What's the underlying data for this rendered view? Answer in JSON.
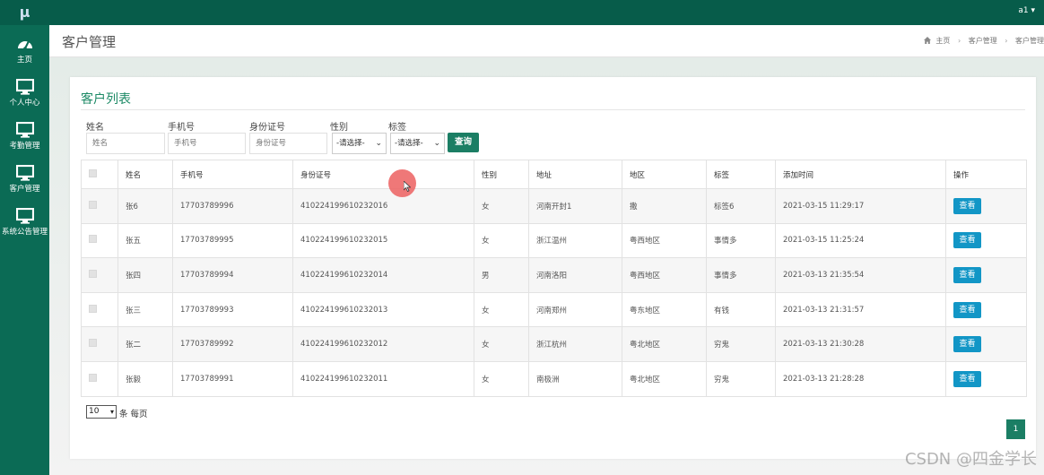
{
  "app": {
    "logo": "μ",
    "user": "a1 ▾"
  },
  "colors": {
    "sidebar": "#0b6b55",
    "topbar": "#075c4a",
    "accent": "#1b7e64",
    "view_button": "#1296c6",
    "title": "#1d8a66"
  },
  "sidebar": {
    "items": [
      {
        "label": "主页",
        "icon": "dashboard-icon"
      },
      {
        "label": "个人中心",
        "icon": "monitor-icon"
      },
      {
        "label": "考勤管理",
        "icon": "monitor-icon"
      },
      {
        "label": "客户管理",
        "icon": "monitor-icon"
      },
      {
        "label": "系统公告管理",
        "icon": "monitor-icon"
      }
    ]
  },
  "header": {
    "title": "客户管理",
    "breadcrumb": [
      "主页",
      "客户管理",
      "客户管理"
    ]
  },
  "panel": {
    "title": "客户列表"
  },
  "search": {
    "fields": [
      {
        "label": "姓名",
        "placeholder": "姓名"
      },
      {
        "label": "手机号",
        "placeholder": "手机号"
      },
      {
        "label": "身份证号",
        "placeholder": "身份证号"
      }
    ],
    "gender": {
      "label": "性别",
      "value": "-请选择-"
    },
    "tag": {
      "label": "标签",
      "value": "-请选择-"
    },
    "button": "查询"
  },
  "table": {
    "headers": [
      "姓名",
      "手机号",
      "身份证号",
      "性别",
      "地址",
      "地区",
      "标签",
      "添加时间",
      "操作"
    ],
    "rows": [
      {
        "name": "张6",
        "phone": "17703789996",
        "id_number": "410224199610232016",
        "gender": "女",
        "address": "河南开封1",
        "region": "撒",
        "tag": "标签6",
        "time": "2021-03-15 11:29:17",
        "action": "查看"
      },
      {
        "name": "张五",
        "phone": "17703789995",
        "id_number": "410224199610232015",
        "gender": "女",
        "address": "浙江温州",
        "region": "粤西地区",
        "tag": "事情多",
        "time": "2021-03-15 11:25:24",
        "action": "查看"
      },
      {
        "name": "张四",
        "phone": "17703789994",
        "id_number": "410224199610232014",
        "gender": "男",
        "address": "河南洛阳",
        "region": "粤西地区",
        "tag": "事情多",
        "time": "2021-03-13 21:35:54",
        "action": "查看"
      },
      {
        "name": "张三",
        "phone": "17703789993",
        "id_number": "410224199610232013",
        "gender": "女",
        "address": "河南郑州",
        "region": "粤东地区",
        "tag": "有钱",
        "time": "2021-03-13 21:31:57",
        "action": "查看"
      },
      {
        "name": "张二",
        "phone": "17703789992",
        "id_number": "410224199610232012",
        "gender": "女",
        "address": "浙江杭州",
        "region": "粤北地区",
        "tag": "穷鬼",
        "time": "2021-03-13 21:30:28",
        "action": "查看"
      },
      {
        "name": "张毅",
        "phone": "17703789991",
        "id_number": "410224199610232011",
        "gender": "女",
        "address": "南极洲",
        "region": "粤北地区",
        "tag": "穷鬼",
        "time": "2021-03-13 21:28:28",
        "action": "查看"
      }
    ]
  },
  "pagination": {
    "page_size": "10",
    "page_size_label": "条 每页",
    "current_page": "1"
  },
  "watermark": "CSDN @四金学长"
}
